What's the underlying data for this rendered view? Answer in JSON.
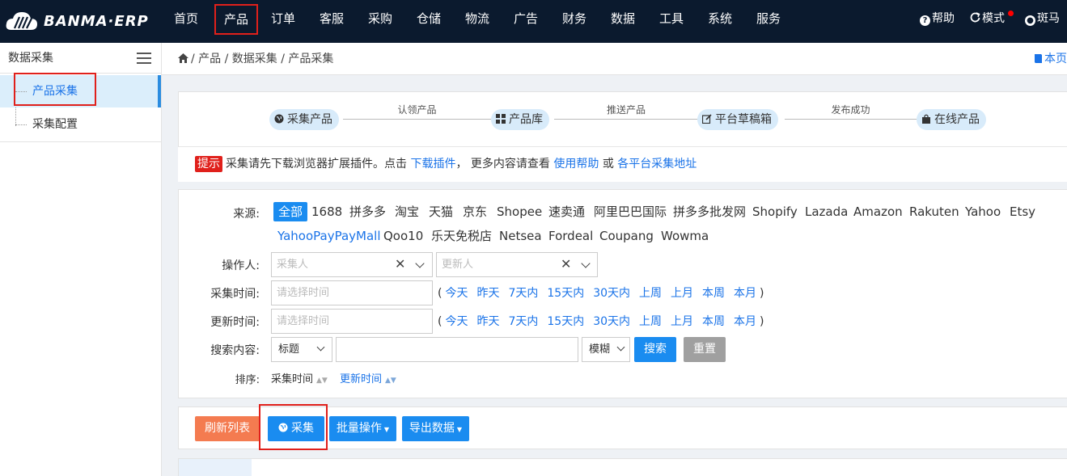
{
  "header": {
    "logo_text": "BANMA·ERP",
    "nav": [
      "首页",
      "产品",
      "订单",
      "客服",
      "采购",
      "仓储",
      "物流",
      "广告",
      "财务",
      "数据",
      "工具",
      "系统",
      "服务"
    ],
    "active_nav": "产品",
    "help": "帮助",
    "mode": "模式",
    "user": "斑马小"
  },
  "sidebar": {
    "title": "数据采集",
    "items": [
      {
        "label": "产品采集",
        "active": true
      },
      {
        "label": "采集配置",
        "active": false
      }
    ]
  },
  "breadcrumb": {
    "text": "/ 产品 / 数据采集 / 产品采集",
    "this_page": "本页"
  },
  "flow": {
    "steps": [
      "采集产品",
      "产品库",
      "平台草稿箱",
      "在线产品"
    ],
    "transitions": [
      "认领产品",
      "推送产品",
      "发布成功"
    ]
  },
  "tip": {
    "tag": "提示",
    "text1": "采集请先下载浏览器扩展插件。点击",
    "link1": "下载插件",
    "text2": "，  更多内容请查看",
    "link2": "使用帮助",
    "text3": "或",
    "link3": "各平台采集地址"
  },
  "filter": {
    "source_label": "来源:",
    "sources_row1": [
      "全部",
      "1688",
      "拼多多",
      "淘宝",
      "天猫",
      "京东",
      "Shopee",
      "速卖通",
      "阿里巴巴国际",
      "拼多多批发网",
      "Shopify",
      "Lazada",
      "Amazon",
      "Rakuten",
      "Yahoo",
      "Etsy"
    ],
    "sources_row2": [
      "YahooPayPayMall",
      "Qoo10",
      "乐天免税店",
      "Netsea",
      "Fordeal",
      "Coupang",
      "Wowma"
    ],
    "active_source": "全部",
    "operator_label": "操作人:",
    "collector_placeholder": "采集人",
    "updater_placeholder": "更新人",
    "collect_time_label": "采集时间:",
    "update_time_label": "更新时间:",
    "time_placeholder": "请选择时间",
    "time_links": [
      "今天",
      "昨天",
      "7天内",
      "15天内",
      "30天内",
      "上周",
      "上月",
      "本周",
      "本月"
    ],
    "search_label": "搜索内容:",
    "search_field": "标题",
    "match_mode": "模糊",
    "search_button": "搜索",
    "reset_button": "重置",
    "sort_label": "排序:",
    "sort_collect": "采集时间",
    "sort_update": "更新时间"
  },
  "actions": {
    "refresh": "刷新列表",
    "collect": "采集",
    "bulk": "批量操作",
    "export": "导出数据"
  },
  "colors": {
    "topbar": "#0b1a2e",
    "primary": "#1a8cf0",
    "highlight_red": "#e0201b",
    "refresh_orange": "#f47b50",
    "reset_gray": "#a0a0a0"
  }
}
